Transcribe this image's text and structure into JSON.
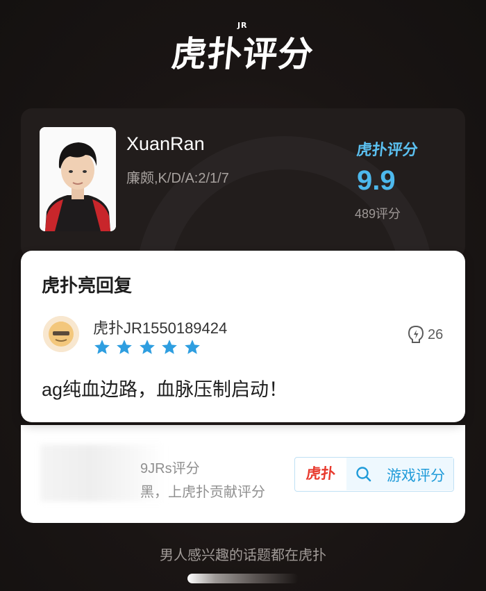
{
  "header": {
    "logo_text": "虎扑评分",
    "logo_badge": "JR"
  },
  "player": {
    "name": "XuanRan",
    "stats": "廉颇,K/D/A:2/1/7",
    "score_brand": "虎扑评分",
    "score": "9.9",
    "rating_count": "489评分"
  },
  "reply": {
    "section_title": "虎扑亮回复",
    "username": "虎扑JR1550189424",
    "stars": 5,
    "likes": "26",
    "comment": "ag纯血边路，血脉压制启动！"
  },
  "promo": {
    "jrs_text": "9JRs评分",
    "contribute_text": "黑，上虎扑贡献评分",
    "button_logo": "虎扑",
    "button_label": "游戏评分"
  },
  "footer": {
    "tagline": "男人感兴趣的话题都在虎扑"
  },
  "colors": {
    "accent": "#4db8ec",
    "star": "#2e9ee0",
    "brand_red": "#e83a2e"
  }
}
